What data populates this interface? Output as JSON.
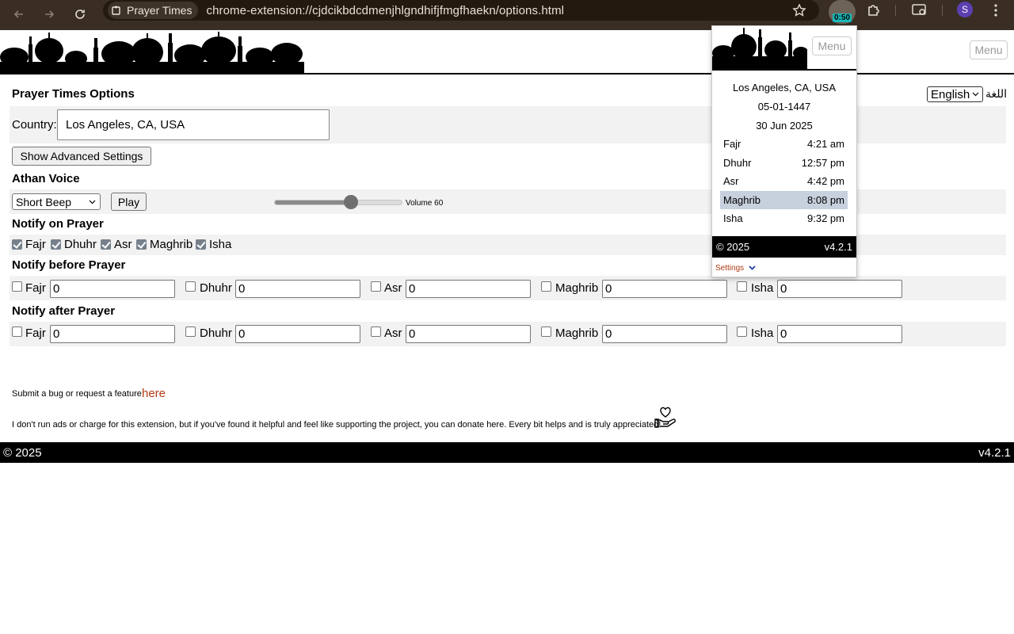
{
  "browser": {
    "tab_chip": "Prayer Times",
    "url": "chrome-extension://cjdcikbdcdmenjhlgndhifjfmgfhaekn/options.html",
    "extension_badge": "0:50",
    "profile_initial": "S"
  },
  "header": {
    "menu_label": "Menu"
  },
  "options": {
    "title": "Prayer Times Options",
    "language_value": "English",
    "language_label": "اللغة",
    "country_label": "Country:",
    "country_value": "Los Angeles, CA, USA",
    "advanced_button": "Show Advanced Settings",
    "athan_title": "Athan Voice",
    "voice_value": "Short Beep",
    "play_button": "Play",
    "volume_label": "Volume 60",
    "volume_level": 60,
    "notify_on_title": "Notify on Prayer",
    "notify_before_title": "Notify before Prayer",
    "notify_after_title": "Notify after Prayer",
    "prayers": [
      "Fajr",
      "Dhuhr",
      "Asr",
      "Maghrib",
      "Isha"
    ],
    "notify_on_checked": [
      true,
      true,
      true,
      true,
      true
    ],
    "before_values": [
      "0",
      "0",
      "0",
      "0",
      "0"
    ],
    "after_values": [
      "0",
      "0",
      "0",
      "0",
      "0"
    ],
    "bug_text": "Submit a bug or request a feature",
    "bug_link": "here",
    "donate_text": "I don't run ads or charge for this extension, but if you've found it helpful and feel like supporting the project, you can donate here. Every bit helps and is truly appreciated!"
  },
  "footer": {
    "copyright": "© 2025",
    "version": "v4.2.1"
  },
  "popup": {
    "menu_label": "Menu",
    "location": "Los Angeles, CA, USA",
    "hijri_date": "05-01-1447",
    "gregorian_date": "30 Jun 2025",
    "times": [
      {
        "name": "Fajr",
        "time": "4:21 am"
      },
      {
        "name": "Dhuhr",
        "time": "12:57 pm"
      },
      {
        "name": "Asr",
        "time": "4:42 pm"
      },
      {
        "name": "Maghrib",
        "time": "8:08 pm"
      },
      {
        "name": "Isha",
        "time": "9:32 pm"
      }
    ],
    "active_index": 3,
    "copyright": "© 2025",
    "version": "v4.2.1",
    "settings_label": "Settings"
  }
}
